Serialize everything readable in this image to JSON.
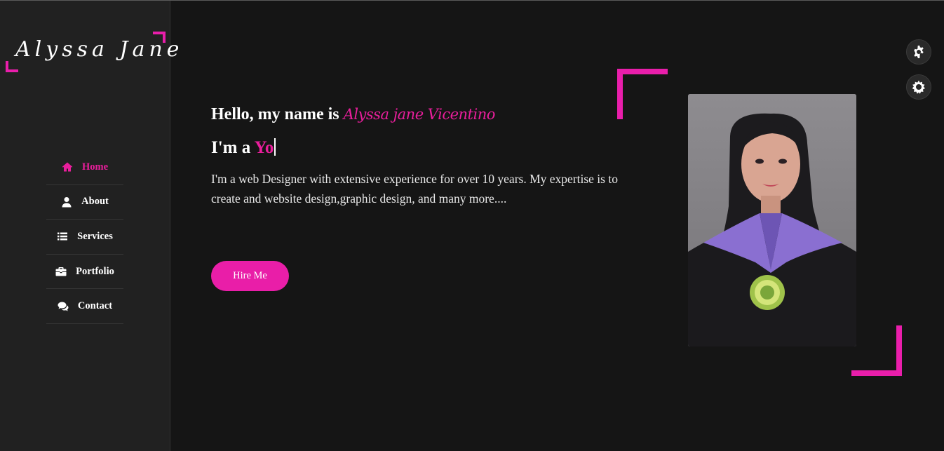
{
  "sidebar": {
    "logo_text": "Alyssa Jane",
    "nav": [
      {
        "label": "Home",
        "icon": "home-icon",
        "active": true
      },
      {
        "label": "About",
        "icon": "user-icon",
        "active": false
      },
      {
        "label": "Services",
        "icon": "list-icon",
        "active": false
      },
      {
        "label": "Portfolio",
        "icon": "briefcase-icon",
        "active": false
      },
      {
        "label": "Contact",
        "icon": "comments-icon",
        "active": false
      }
    ]
  },
  "hero": {
    "greeting": "Hello, my name is",
    "name": "Alyssa jane Vicentino",
    "role_prefix": "I'm a",
    "role_typed": "Yo",
    "description": "I'm a web Designer with extensive experience for over 10 years. My expertise is to create and website design,graphic design, and many more....",
    "cta": "Hire Me"
  },
  "widgets": {
    "settings_icon": "gear-icon",
    "theme_icon": "sun-icon"
  },
  "colors": {
    "accent": "#e91e9c",
    "background": "#151515",
    "sidebar": "#212121"
  }
}
